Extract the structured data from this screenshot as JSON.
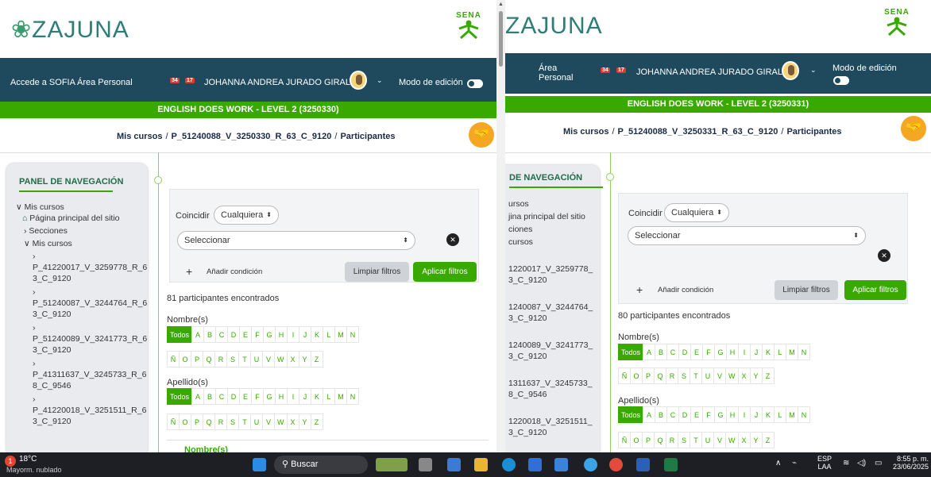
{
  "left": {
    "logo": "ZAJUNA",
    "sena": "SENA",
    "nav": {
      "sofia": "Accede a SOFIA",
      "personal": "Área Personal",
      "bell_count": "34",
      "msg_count": "17",
      "user": "JOHANNA ANDREA JURADO GIRALDO",
      "edit_mode": "Modo de edición"
    },
    "course_title": "ENGLISH DOES WORK - LEVEL 2 (3250330)",
    "breadcrumb": {
      "mis_cursos": "Mis cursos",
      "sep": "/",
      "course": "P_51240088_V_3250330_R_63_C_9120",
      "page": "Participantes"
    },
    "panel": {
      "title": "PANEL DE NAVEGACIÓN",
      "items": [
        "Mis cursos",
        "Página principal del sitio",
        "Secciones",
        "Mis cursos",
        "P_41220017_V_3259778_R_6",
        "3_C_9120",
        "P_51240087_V_3244764_R_6",
        "3_C_9120",
        "P_51240089_V_3241773_R_6",
        "3_C_9120",
        "P_41311637_V_3245733_R_6",
        "8_C_9546",
        "P_41220018_V_3251511_R_6",
        "3_C_9120"
      ]
    },
    "filter": {
      "match_label": "Coincidir",
      "match_value": "Cualquiera",
      "select_placeholder": "Seleccionar",
      "add_condition": "Añadir condición",
      "clear": "Limpiar filtros",
      "apply": "Aplicar filtros"
    },
    "found": "81 participantes encontrados",
    "first_name_label": "Nombre(s)",
    "last_name_label": "Apellido(s)",
    "table_header": "Nombre(s)"
  },
  "right": {
    "logo": "ZAJUNA",
    "sena": "SENA",
    "nav": {
      "personal_1": "Área",
      "personal_2": "Personal",
      "bell_count": "34",
      "msg_count": "17",
      "user": "JOHANNA ANDREA JURADO GIRALDO",
      "edit_mode": "Modo de edición"
    },
    "course_title": "ENGLISH DOES WORK - LEVEL 2 (3250331)",
    "breadcrumb": {
      "mis_cursos": "Mis cursos",
      "sep": "/",
      "course": "P_51240088_V_3250331_R_63_C_9120",
      "page": "Participantes"
    },
    "panel": {
      "title": "DE NAVEGACIÓN",
      "items": [
        "ursos",
        "jina principal del sitio",
        "ciones",
        "cursos",
        "1220017_V_3259778_",
        "3_C_9120",
        "1240087_V_3244764_",
        "3_C_9120",
        "1240089_V_3241773_",
        "3_C_9120",
        "1311637_V_3245733_",
        "8_C_9546",
        "1220018_V_3251511_",
        "3_C_9120"
      ]
    },
    "filter": {
      "match_label": "Coincidir",
      "match_value": "Cualquiera",
      "select_placeholder": "Seleccionar",
      "add_condition": "Añadir condición",
      "clear": "Limpiar filtros",
      "apply": "Aplicar filtros"
    },
    "found": "80 participantes encontrados",
    "first_name_label": "Nombre(s)",
    "last_name_label": "Apellido(s)"
  },
  "letters_row1": [
    "Todos",
    "A",
    "B",
    "C",
    "D",
    "E",
    "F",
    "G",
    "H",
    "I",
    "J",
    "K",
    "L",
    "M",
    "N"
  ],
  "letters_row2": [
    "Ñ",
    "O",
    "P",
    "Q",
    "R",
    "S",
    "T",
    "U",
    "V",
    "W",
    "X",
    "Y",
    "Z"
  ],
  "taskbar": {
    "weather_badge": "1",
    "temp": "18°C",
    "weather": "Mayorm. nublado",
    "search": "Buscar",
    "lang_1": "ESP",
    "lang_2": "LAA",
    "time": "8:55 p. m.",
    "date": "23/06/2025"
  }
}
